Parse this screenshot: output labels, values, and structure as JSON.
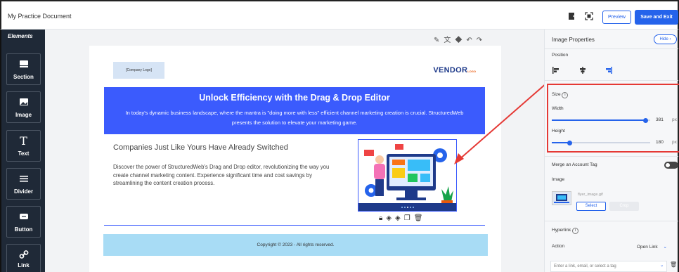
{
  "header": {
    "doc_title": "My Practice Document",
    "preview_label": "Preview",
    "save_label": "Save and Exit"
  },
  "sidebar": {
    "title": "Elements",
    "items": [
      {
        "label": "Section",
        "icon": "section-icon"
      },
      {
        "label": "Image",
        "icon": "image-icon"
      },
      {
        "label": "Text",
        "icon": "text-icon"
      },
      {
        "label": "Divider",
        "icon": "divider-icon"
      },
      {
        "label": "Button",
        "icon": "button-icon"
      },
      {
        "label": "Link",
        "icon": "link-icon"
      }
    ]
  },
  "email": {
    "logo_placeholder": "[Company Logo]",
    "vendor": "VENDOR",
    "vendor_sub": "LOGO",
    "hero_title": "Unlock Efficiency with the Drag & Drop Editor",
    "hero_text": "In today's dynamic business landscape, where the mantra is \"doing more with less\" efficient channel marketing creation is crucial. StructuredWeb presents the solution to elevate your marketing game.",
    "sub_heading": "Companies Just Like Yours Have Already Switched",
    "body_text": "Discover the power of StructuredWeb's Drag and Drop editor, revolutionizing the way you create channel marketing content. Experience significant time and cost savings by streamlining the content creation process.",
    "footer": "Copyright © 2023 - All rights reserved."
  },
  "panel": {
    "title": "Image Properties",
    "hide_label": "Hide",
    "position_label": "Position",
    "size_label": "Size",
    "width_label": "Width",
    "width_value": "381",
    "width_unit": "px",
    "width_fraction": 0.95,
    "height_label": "Height",
    "height_value": "180",
    "height_unit": "px",
    "height_fraction": 0.18,
    "merge_label": "Merge an Account Tag",
    "image_label": "Image",
    "image_file": "flyer_image.gif",
    "select_label": "Select",
    "crop_label": "Crop",
    "hyperlink_label": "Hyperlink",
    "action_label": "Action",
    "action_value": "Open Link",
    "link_placeholder": "Enter a link, email, or select a tag"
  },
  "colors": {
    "accent": "#2563eb",
    "hero_bg": "#3b5bfd",
    "sidebar_bg": "#1f2937",
    "footer_bg": "#a8dcf5",
    "highlight": "#e53935"
  }
}
